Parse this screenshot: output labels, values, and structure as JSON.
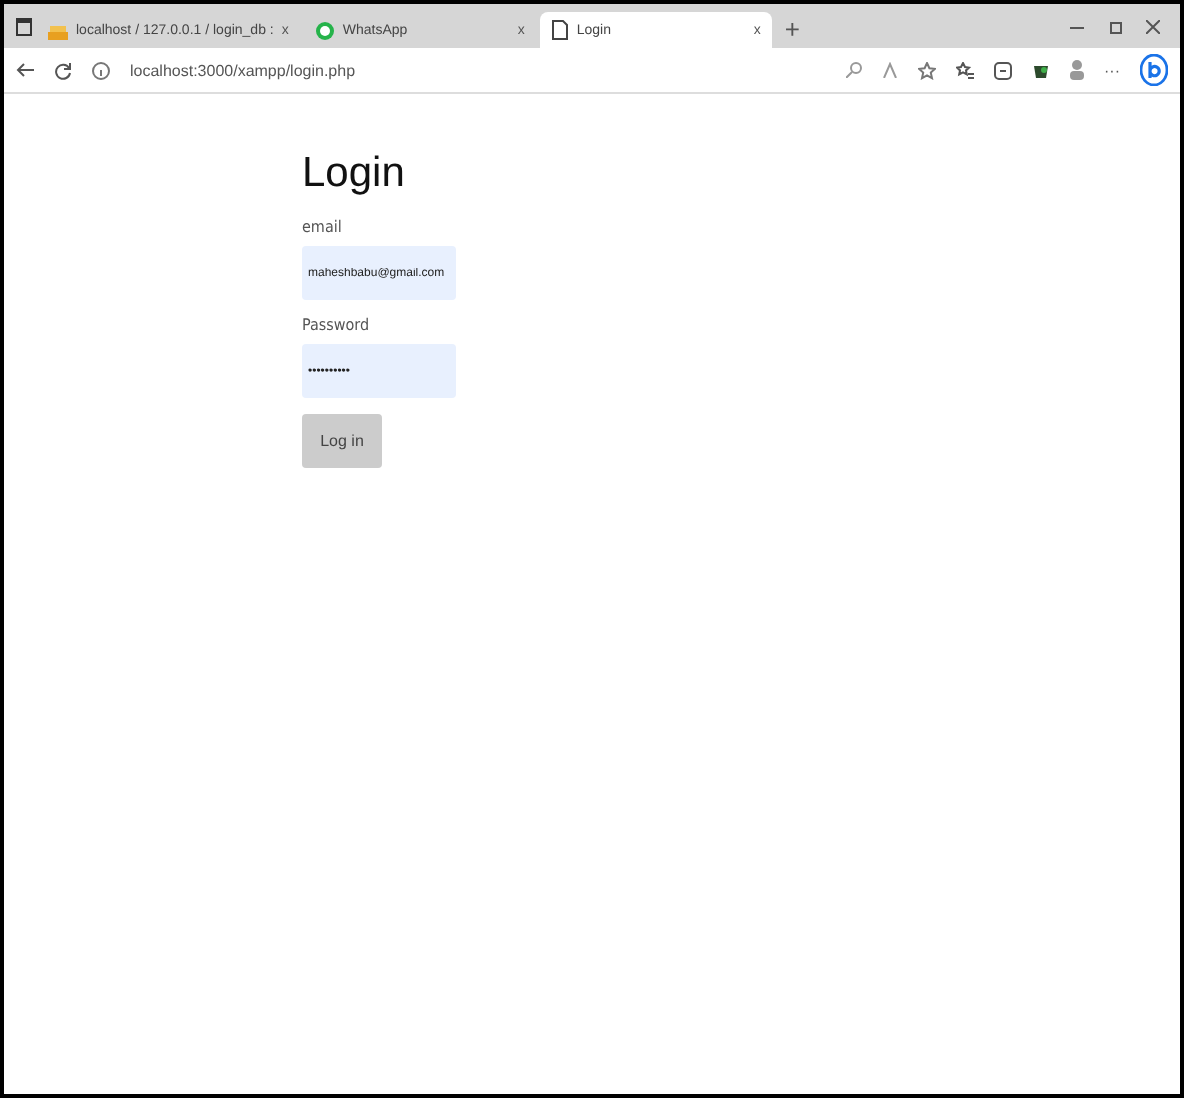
{
  "browser": {
    "tabs": [
      {
        "title": "localhost / 127.0.0.1 / login_db :",
        "close": "x",
        "selected": false,
        "kind": "db"
      },
      {
        "title": "WhatsApp",
        "close": "x",
        "selected": false,
        "kind": "chat"
      },
      {
        "title": "Login",
        "close": "x",
        "selected": true,
        "kind": "page"
      }
    ],
    "new_tab": "+",
    "url": "localhost:3000/xampp/login.php",
    "more": "···"
  },
  "form": {
    "heading": "Login",
    "fields": [
      {
        "label": "email",
        "value": "maheshbabu@gmail.com"
      },
      {
        "label": "Password",
        "value": "••••••••••"
      }
    ],
    "button": "Log in"
  }
}
